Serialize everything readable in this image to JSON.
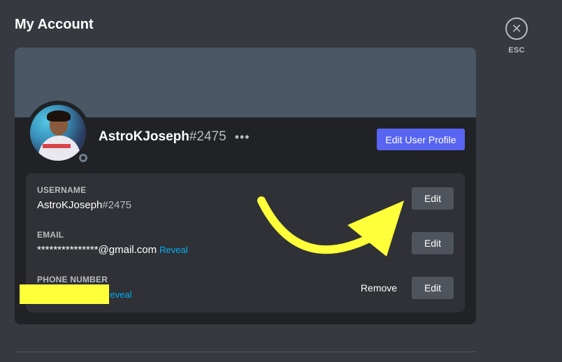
{
  "page": {
    "title": "My Account"
  },
  "close": {
    "esc_label": "ESC",
    "icon": "close-icon"
  },
  "profile": {
    "username": "AstroKJoseph",
    "discriminator": "#2475",
    "more_icon": "more-horizontal-icon",
    "edit_profile_label": "Edit User Profile",
    "status": "offline"
  },
  "fields": {
    "username": {
      "label": "USERNAME",
      "value": "AstroKJoseph",
      "tag": "#2475",
      "edit_label": "Edit"
    },
    "email": {
      "label": "EMAIL",
      "value": "***************@gmail.com",
      "reveal_label": "Reveal",
      "edit_label": "Edit"
    },
    "phone": {
      "label": "PHONE NUMBER",
      "reveal_label": "Reveal",
      "remove_label": "Remove",
      "edit_label": "Edit"
    }
  },
  "colors": {
    "background": "#36393f",
    "card": "#202225",
    "banner": "#4a5764",
    "panel": "#2f3136",
    "brand": "#5865f2",
    "secondary_button": "#4f545c",
    "link": "#00b0f4",
    "annotation": "#ffff3a"
  }
}
